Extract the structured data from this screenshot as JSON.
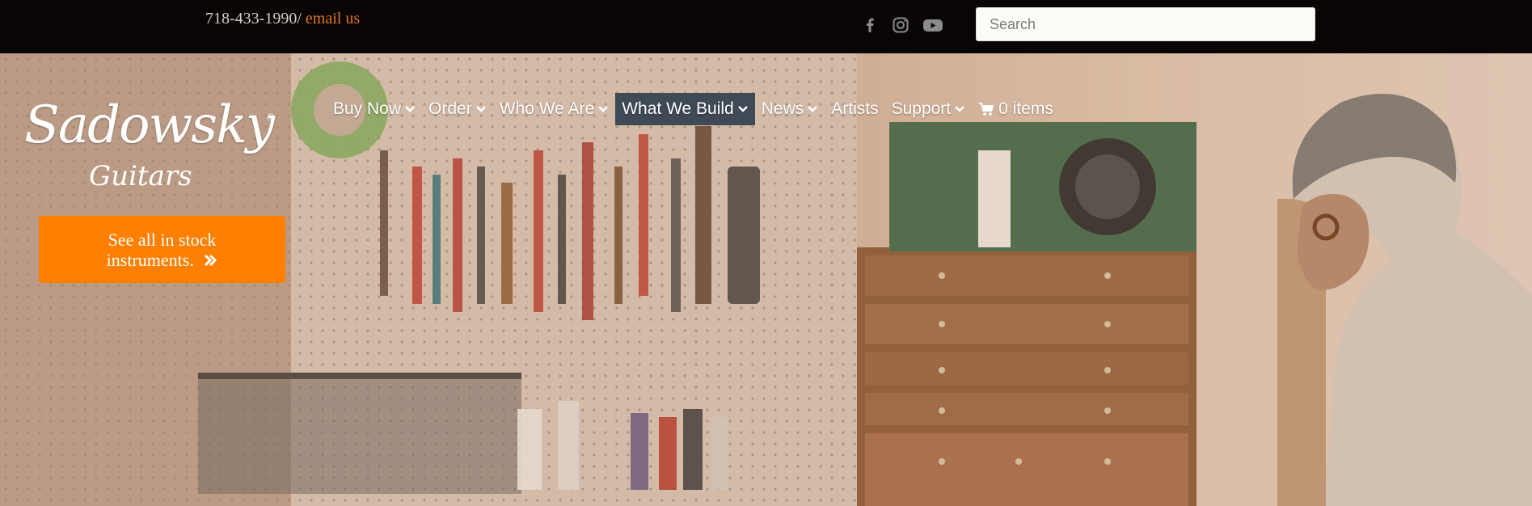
{
  "topbar": {
    "phone": "718-433-1990/",
    "email_label": "email us",
    "social": [
      "facebook-icon",
      "instagram-icon",
      "youtube-icon"
    ],
    "search_placeholder": "Search"
  },
  "logo": {
    "main": "Sadowsky",
    "sub": "Guitars",
    "registered": "®"
  },
  "cta": {
    "line1": "See all in stock",
    "line2": "instruments."
  },
  "nav": {
    "items": [
      {
        "label": "Buy Now",
        "dropdown": true
      },
      {
        "label": "Order",
        "dropdown": true
      },
      {
        "label": "Who We Are",
        "dropdown": true
      },
      {
        "label": "What We Build",
        "dropdown": true,
        "active": true
      },
      {
        "label": "News",
        "dropdown": true
      },
      {
        "label": "Artists",
        "dropdown": false
      },
      {
        "label": "Support",
        "dropdown": true
      }
    ],
    "cart_label": "0 items"
  },
  "colors": {
    "accent_orange": "#ff7f00",
    "email_link": "#e0762a",
    "nav_active_bg": "#3f4a56",
    "topbar_bg": "#080504"
  }
}
